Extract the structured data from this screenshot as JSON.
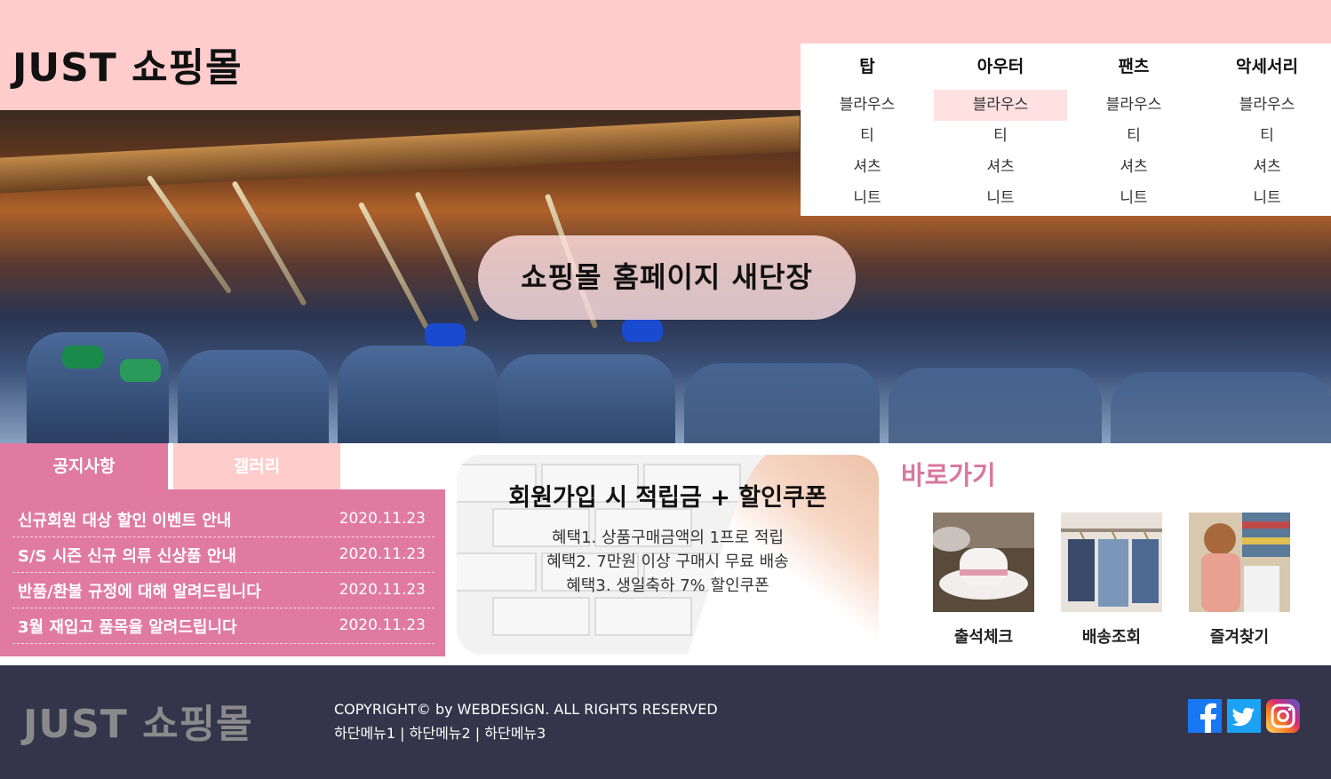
{
  "header": {
    "logo": "JUST  쇼핑몰"
  },
  "nav": {
    "columns": [
      {
        "title": "탑",
        "items": [
          "블라우스",
          "티",
          "셔츠",
          "니트"
        ]
      },
      {
        "title": "아우터",
        "items": [
          "블라우스",
          "티",
          "셔츠",
          "니트"
        ]
      },
      {
        "title": "팬츠",
        "items": [
          "블라우스",
          "티",
          "셔츠",
          "니트"
        ]
      },
      {
        "title": "악세서리",
        "items": [
          "블라우스",
          "티",
          "셔츠",
          "니트"
        ]
      }
    ],
    "highlighted": "아우터 > 블라우스"
  },
  "banner": {
    "slogan": "쇼핑몰 홈페이지 새단장"
  },
  "tabs": {
    "notice": "공지사항",
    "gallery": "갤러리"
  },
  "notices": [
    {
      "title": "신규회원 대상 할인 이벤트 안내",
      "date": "2020.11.23"
    },
    {
      "title": "S/S 시즌 신규 의류 신상품 안내",
      "date": "2020.11.23"
    },
    {
      "title": "반품/환불 규정에 대해 알려드립니다",
      "date": "2020.11.23"
    },
    {
      "title": "3월 재입고 품목을 알려드립니다",
      "date": "2020.11.23"
    }
  ],
  "promo": {
    "title": "회원가입 시 적립금 + 할인쿠폰",
    "lines": [
      "혜택1. 상품구매금액의 1프로 적립",
      "혜택2. 7만원 이상 구매시 무료 배송",
      "혜택3. 생일축하 7% 할인쿠폰"
    ]
  },
  "shortcut": {
    "title": "바로가기",
    "items": [
      "출석체크",
      "배송조회",
      "즐겨찾기"
    ]
  },
  "footer": {
    "logo": "JUST  쇼핑몰",
    "copyright": "COPYRIGHT© by WEBDESIGN. ALL RIGHTS RESERVED",
    "menu": [
      "하단메뉴1",
      "하단메뉴2",
      "하단메뉴3"
    ],
    "sns": [
      "facebook-icon",
      "twitter-icon",
      "instagram-icon"
    ]
  },
  "colors": {
    "header_bg": "#ffcccc",
    "notice_pink": "#e07aa0",
    "shortcut_title": "#d9779c",
    "footer_bg": "#34344a"
  }
}
